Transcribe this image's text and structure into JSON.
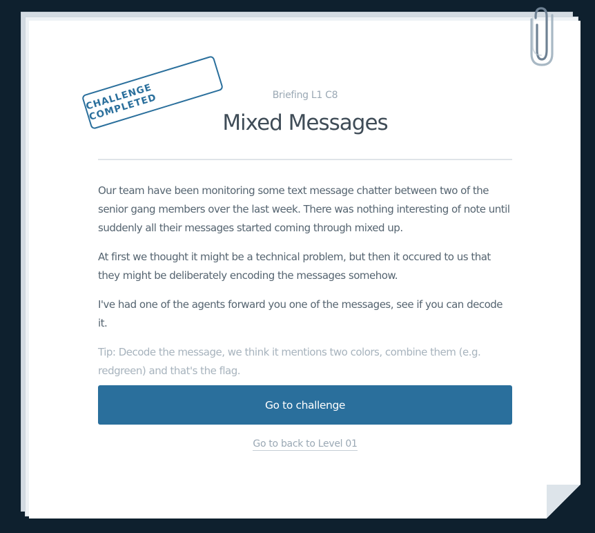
{
  "briefing": {
    "stamp_text": "CHALLENGE COMPLETED",
    "subtitle": "Briefing L1 C8",
    "title": "Mixed Messages",
    "paragraphs": [
      "Our team have been monitoring some text message chatter between two of the senior gang members over the last week. There was nothing interesting of note until suddenly all their messages started coming through mixed up.",
      "At first we thought it might be a technical problem, but then it occured to us that they might be deliberately encoding the messages somehow.",
      "I've had one of the agents forward you one of the messages, see if you can decode it."
    ],
    "tip": "Tip: Decode the message, we think it mentions two colors, combine them (e.g. redgreen) and that's the flag.",
    "cta_label": "Go to challenge",
    "back_link_label": "Go to back to Level 01"
  },
  "colors": {
    "background": "#0e202e",
    "accent": "#2a6f9c",
    "paper": "#ffffff"
  },
  "icons": {
    "paperclip": "paperclip-icon",
    "page_curl": "page-curl"
  }
}
